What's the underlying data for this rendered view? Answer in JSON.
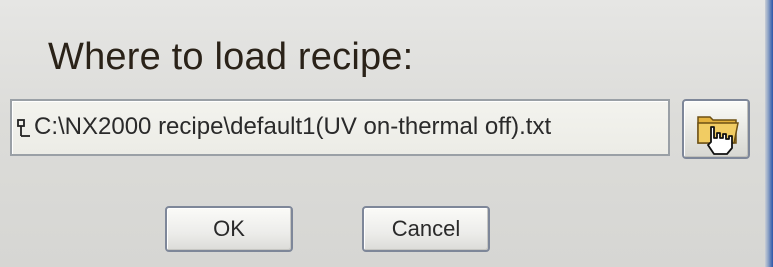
{
  "dialog": {
    "prompt": "Where to load recipe:",
    "path_value": "C:\\NX2000 recipe\\default1(UV on-thermal off).txt",
    "ok_label": "OK",
    "cancel_label": "Cancel",
    "icons": {
      "path_indicator": "tree-connector-icon",
      "browse": "folder-hand-icon"
    }
  }
}
